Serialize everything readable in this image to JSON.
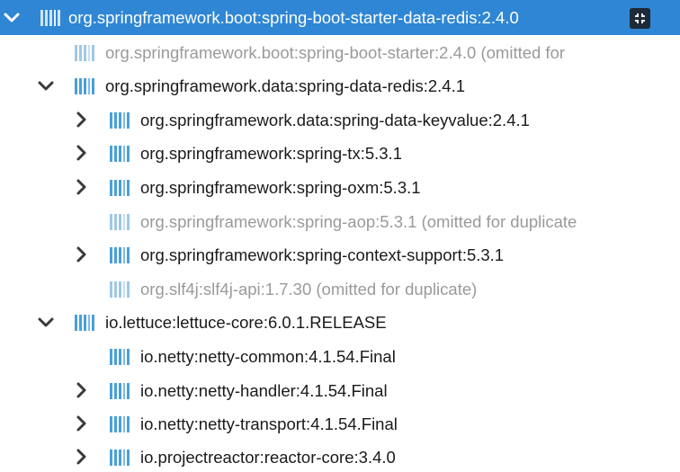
{
  "tree": {
    "colors": {
      "selected_bg": "#2f86d4",
      "library_icon": "#4aa0d8",
      "library_icon_omitted": "#9fc8e6",
      "text": "#1a1a1a",
      "text_omitted": "#9a9a9a"
    },
    "selected_row_action_icon": "collapse-icon",
    "rows": [
      {
        "label": "org.springframework.boot:spring-boot-starter-data-redis:2.4.0",
        "depth": 0,
        "arrow": "down",
        "state": "selected"
      },
      {
        "label": "org.springframework.boot:spring-boot-starter:2.4.0 (omitted for",
        "depth": 1,
        "arrow": "none",
        "state": "omitted"
      },
      {
        "label": "org.springframework.data:spring-data-redis:2.4.1",
        "depth": 1,
        "arrow": "down",
        "state": "normal"
      },
      {
        "label": "org.springframework.data:spring-data-keyvalue:2.4.1",
        "depth": 2,
        "arrow": "right",
        "state": "normal"
      },
      {
        "label": "org.springframework:spring-tx:5.3.1",
        "depth": 2,
        "arrow": "right",
        "state": "normal"
      },
      {
        "label": "org.springframework:spring-oxm:5.3.1",
        "depth": 2,
        "arrow": "right",
        "state": "normal"
      },
      {
        "label": "org.springframework:spring-aop:5.3.1 (omitted for duplicate",
        "depth": 2,
        "arrow": "none",
        "state": "omitted"
      },
      {
        "label": "org.springframework:spring-context-support:5.3.1",
        "depth": 2,
        "arrow": "right",
        "state": "normal"
      },
      {
        "label": "org.slf4j:slf4j-api:1.7.30 (omitted for duplicate)",
        "depth": 2,
        "arrow": "none",
        "state": "omitted"
      },
      {
        "label": "io.lettuce:lettuce-core:6.0.1.RELEASE",
        "depth": 1,
        "arrow": "down",
        "state": "normal"
      },
      {
        "label": "io.netty:netty-common:4.1.54.Final",
        "depth": 2,
        "arrow": "none",
        "state": "normal"
      },
      {
        "label": "io.netty:netty-handler:4.1.54.Final",
        "depth": 2,
        "arrow": "right",
        "state": "normal"
      },
      {
        "label": "io.netty:netty-transport:4.1.54.Final",
        "depth": 2,
        "arrow": "right",
        "state": "normal"
      },
      {
        "label": "io.projectreactor:reactor-core:3.4.0",
        "depth": 2,
        "arrow": "right",
        "state": "normal"
      }
    ]
  }
}
